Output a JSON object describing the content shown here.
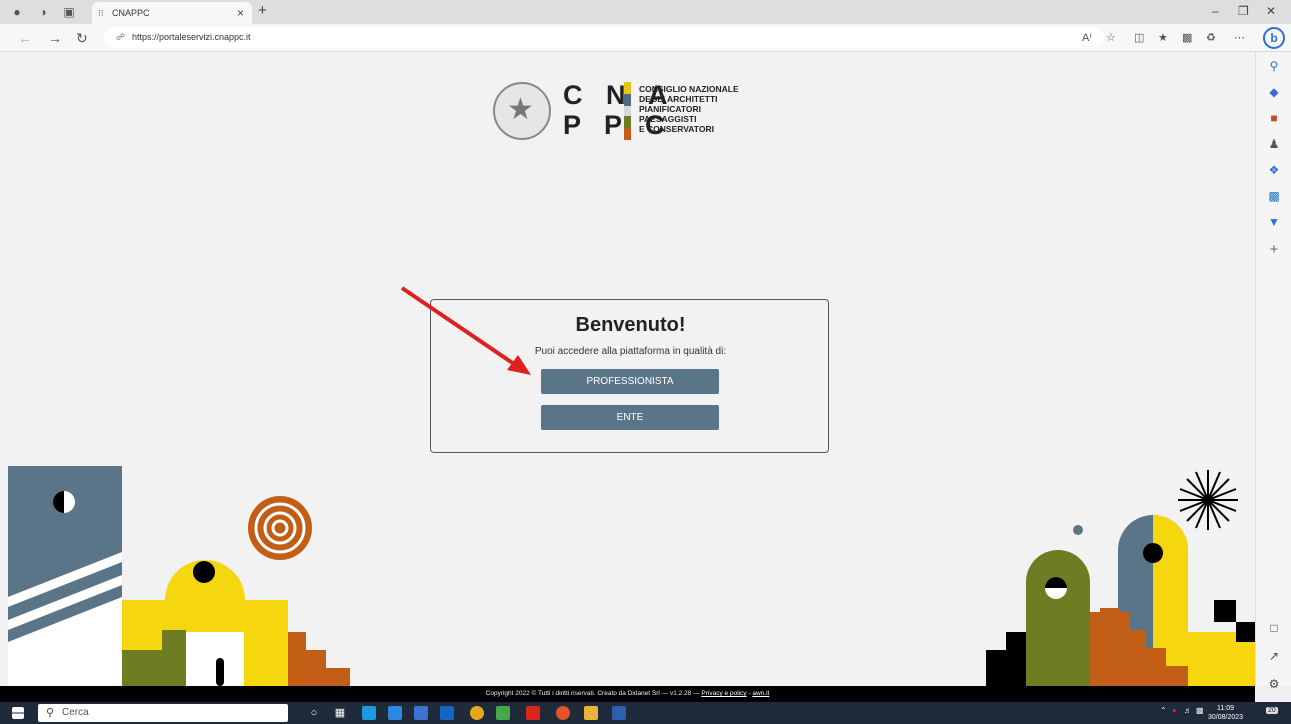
{
  "browser": {
    "tab_title": "CNAPPC",
    "url": "https://portaleservizi.cnappc.it",
    "tab_close": "×",
    "new_tab": "+"
  },
  "logo": {
    "line1": "C N A",
    "line2": "P P C",
    "org_name": "CONSIGLIO NAZIONALE\nDEGLI ARCHITETTI\nPIANIFICATORI\nPAESAGGISTI\nE CONSERVATORI",
    "bar_colors": [
      "#e9c21a",
      "#4f6c86",
      "#d8d8d8",
      "#6e7d21",
      "#c25e16"
    ]
  },
  "welcome": {
    "title": "Benvenuto!",
    "subtitle": "Puoi accedere alla piattaforma in qualità di:",
    "buttons": [
      "PROFESSIONISTA",
      "ENTE"
    ]
  },
  "footer": {
    "copyright": "Copyright 2022 © Tutti i diritti riservati. Creato da Didanet Srl — v1.2.28 —",
    "privacy": "Privacy e policy",
    "sep": " - ",
    "awn": "awn.it"
  },
  "taskbar": {
    "search_placeholder": "Cerca",
    "time": "11:09",
    "date": "30/08/2023",
    "notifications": "20"
  },
  "colors": {
    "accent_button": "#5a7488",
    "yellow": "#f5d60f",
    "olive": "#6e7d21",
    "orange": "#c25e16",
    "slate": "#5a7488",
    "annotation_arrow": "#e02020"
  }
}
